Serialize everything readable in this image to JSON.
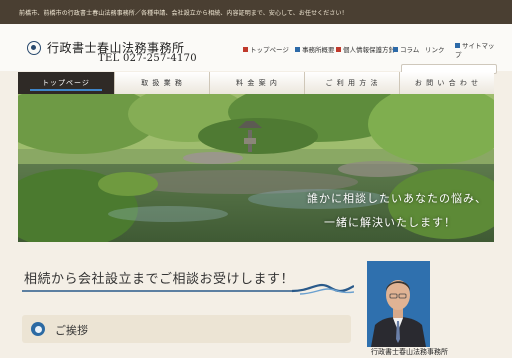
{
  "topbar": {
    "text": "前橋市、前橋市の行政書士春山法務事務所／各種申請、会社設立から相続、内容証明まで、安心して、お任せください！"
  },
  "header": {
    "office_name": "行政書士春山法務事務所",
    "tel": "TEL 027-257-4170"
  },
  "util_nav": [
    {
      "label": "トップページ"
    },
    {
      "label": "事務所概要"
    },
    {
      "label": "個人情報保護方針"
    },
    {
      "label": "コラム"
    },
    {
      "label": "リンク"
    },
    {
      "label": "サイトマップ"
    }
  ],
  "search": {
    "placeholder": ""
  },
  "nav": [
    {
      "label": "トップページ",
      "active": true
    },
    {
      "label": "取 扱 業 務"
    },
    {
      "label": "料 金 案 内"
    },
    {
      "label": "ご 利 用 方 法"
    },
    {
      "label": "お 問 い 合 わ せ"
    }
  ],
  "hero": {
    "line1": "誰かに相談したいあなたの悩み、",
    "line2": "一緒に解決いたします！"
  },
  "main": {
    "heading": "相続から会社設立までご相談お受けします！",
    "greeting_title": "ご挨拶"
  },
  "sidebar": {
    "photo_caption": "行政書士春山法務事務所"
  },
  "colors": {
    "topbar": "#4a3f32",
    "nav_active": "#2f2a26",
    "accent_blue": "#2c6aa3",
    "page_bg": "#f4efe6"
  }
}
